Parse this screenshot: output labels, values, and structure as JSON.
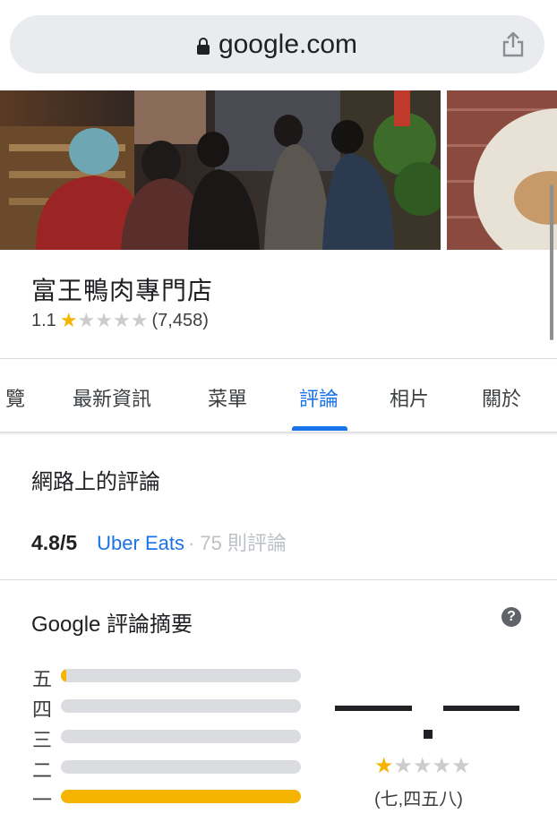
{
  "browser": {
    "domain": "google.com"
  },
  "business": {
    "name": "富王鴨肉專門店",
    "rating": "1.1",
    "stars_filled": 1,
    "stars_total": 5,
    "review_count": "(7,458)"
  },
  "tabs": [
    {
      "label": "覽",
      "active": false
    },
    {
      "label": "最新資訊",
      "active": false
    },
    {
      "label": "菜單",
      "active": false
    },
    {
      "label": "評論",
      "active": true
    },
    {
      "label": "相片",
      "active": false
    },
    {
      "label": "關於",
      "active": false
    }
  ],
  "web_reviews": {
    "title": "網路上的評論",
    "score": "4.8/5",
    "source": "Uber Eats",
    "count": "· 75 則評論"
  },
  "summary": {
    "title": "Google 評論摘要",
    "help": "?",
    "distribution": [
      {
        "label": "五",
        "fraction": 0.02
      },
      {
        "label": "四",
        "fraction": 0.0
      },
      {
        "label": "三",
        "fraction": 0.0
      },
      {
        "label": "二",
        "fraction": 0.0
      },
      {
        "label": "一",
        "fraction": 1.0
      }
    ],
    "stars_filled": 1,
    "stars_total": 5,
    "count": "(七,四五八)"
  },
  "colors": {
    "accent": "#1a73e8",
    "star": "#f4b400",
    "track": "#dadce0"
  },
  "icons": [
    "lock-icon",
    "share-icon",
    "star-icon",
    "help-icon"
  ]
}
